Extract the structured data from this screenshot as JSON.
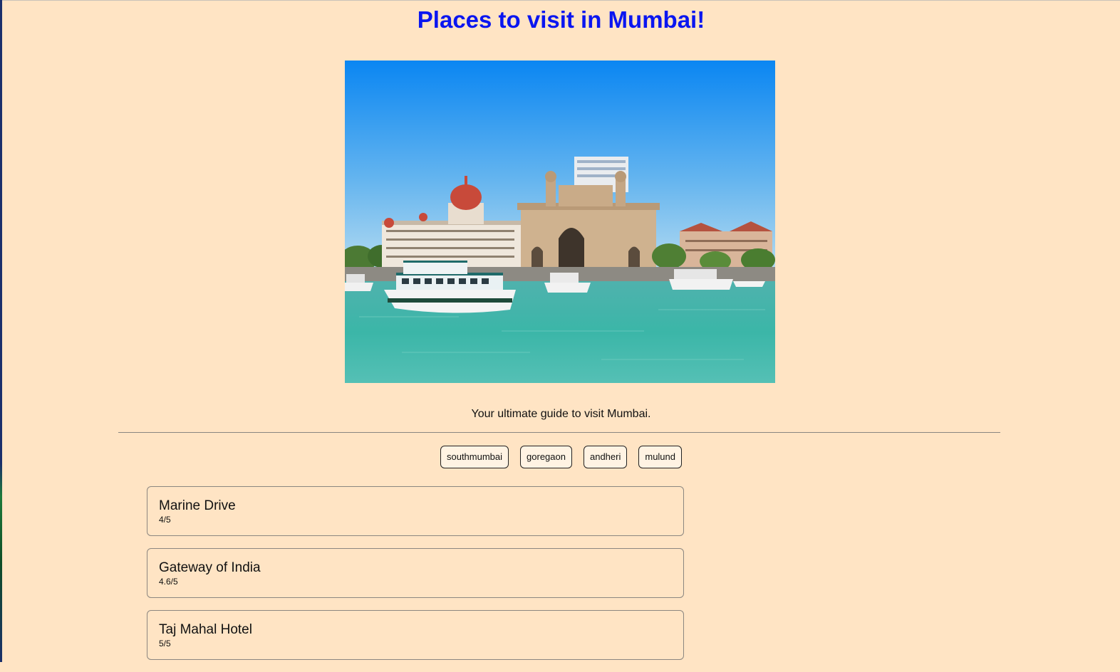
{
  "page": {
    "title": "Places to visit in Mumbai!",
    "subtitle": "Your ultimate guide to visit Mumbai.",
    "title_color": "#0a16f0",
    "background_color": "#ffe4c4"
  },
  "hero_image": {
    "alt": "Gateway of India and Taj Mahal Hotel seen from the harbour"
  },
  "tags": [
    {
      "label": "southmumbai"
    },
    {
      "label": "goregaon"
    },
    {
      "label": "andheri"
    },
    {
      "label": "mulund"
    }
  ],
  "places": [
    {
      "name": "Marine Drive",
      "rating": "4/5"
    },
    {
      "name": "Gateway of India",
      "rating": "4.6/5"
    },
    {
      "name": "Taj Mahal Hotel",
      "rating": "5/5"
    }
  ]
}
